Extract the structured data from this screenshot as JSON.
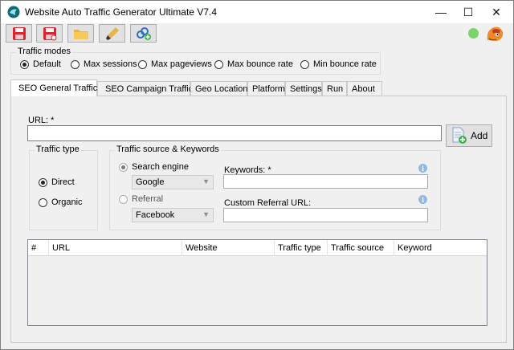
{
  "window": {
    "title": "Website Auto Traffic Generator Ultimate V7.4",
    "controls": {
      "minimize": "—",
      "maximize": "☐",
      "close": "✕"
    }
  },
  "toolbar": {
    "buttons": [
      {
        "name": "save-icon",
        "color": "#d9262e"
      },
      {
        "name": "save-as-icon",
        "color": "#d9262e"
      },
      {
        "name": "open-folder-icon",
        "color": "#f5b335"
      },
      {
        "name": "clean-brush-icon",
        "color": "#e6b54a"
      },
      {
        "name": "add-link-icon",
        "color": "#2f6dc4"
      }
    ],
    "status_color": "#7cd46a"
  },
  "traffic_modes": {
    "title": "Traffic modes",
    "options": [
      "Default",
      "Max sessions",
      "Max pageviews",
      "Max bounce rate",
      "Min bounce rate"
    ],
    "selected": "Default"
  },
  "tabs": [
    {
      "label": "SEO General Traffic",
      "icon": "youtube-red-icon",
      "active": true
    },
    {
      "label": "SEO Campaign Traffic",
      "icon": "campaign-blue-icon",
      "active": false
    },
    {
      "label": "Geo Location",
      "active": false
    },
    {
      "label": "Platform",
      "active": false
    },
    {
      "label": "Settings",
      "active": false
    },
    {
      "label": "Run",
      "active": false
    },
    {
      "label": "About",
      "active": false
    }
  ],
  "seo_general": {
    "url_label": "URL: *",
    "url_value": "",
    "add_label": "Add",
    "traffic_type": {
      "title": "Traffic type",
      "options": [
        "Direct",
        "Organic"
      ],
      "selected": "Direct"
    },
    "traffic_source": {
      "title": "Traffic source & Keywords",
      "search_engine_label": "Search engine",
      "search_engine_value": "Google",
      "referral_label": "Referral",
      "referral_value": "Facebook",
      "keywords_label": "Keywords: *",
      "keywords_value": "",
      "custom_referral_label": "Custom Referral URL:",
      "custom_referral_value": ""
    },
    "table": {
      "columns": [
        "#",
        "URL",
        "Website",
        "Traffic type",
        "Traffic source",
        "Keyword"
      ],
      "rows": []
    }
  },
  "colors": {
    "info": "#8eb9e6",
    "tab_active_bg": "#ffffff",
    "window_bg": "#f0f0f0"
  }
}
